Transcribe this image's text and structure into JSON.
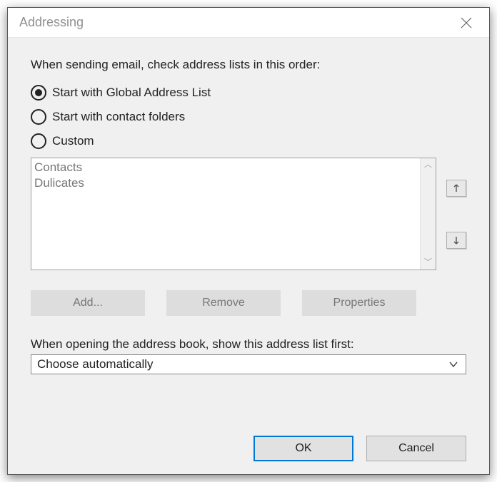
{
  "title": "Addressing",
  "instruction": "When sending email, check address lists in this order:",
  "radios": {
    "gal": "Start with Global Address List",
    "contacts": "Start with contact folders",
    "custom": "Custom",
    "selected": "gal"
  },
  "list_items": [
    "Contacts",
    "Dulicates"
  ],
  "buttons": {
    "add": "Add...",
    "remove": "Remove",
    "properties": "Properties",
    "ok": "OK",
    "cancel": "Cancel"
  },
  "second_label": "When opening the address book, show this address list first:",
  "dropdown_value": "Choose automatically"
}
